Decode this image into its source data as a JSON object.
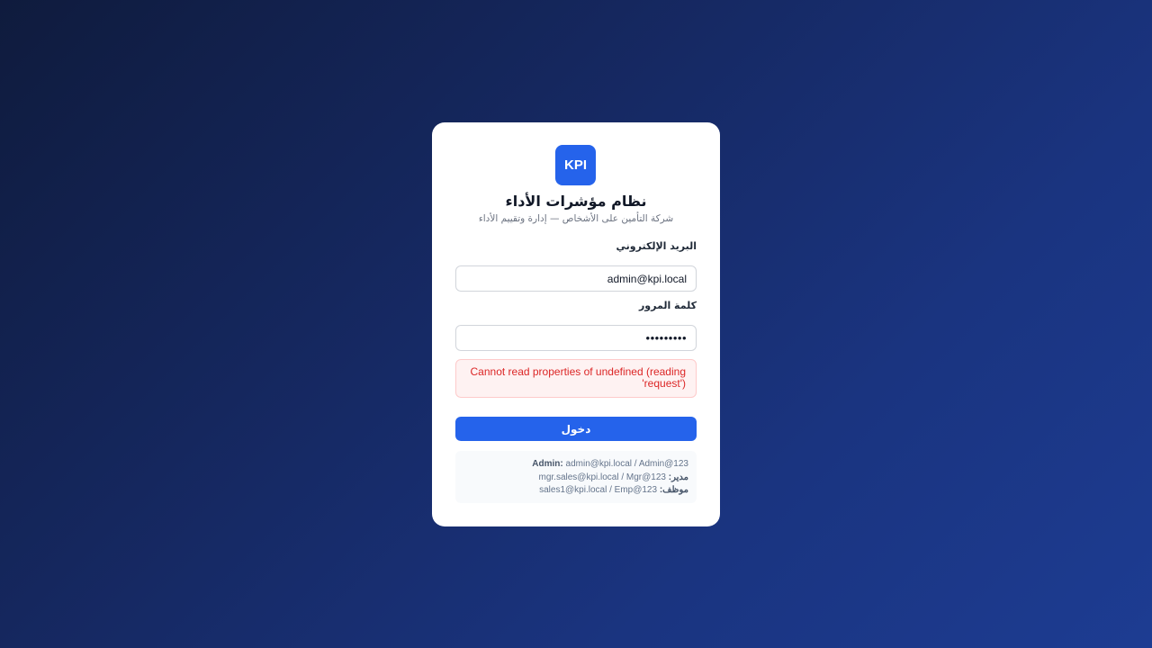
{
  "logo": {
    "text": "KPI"
  },
  "title": "نظام مؤشرات الأداء",
  "subtitle": "شركة التأمين على الأشخاص — إدارة وتقييم الأداء",
  "form": {
    "email_label": "البريد الإلكتروني",
    "email_value": "admin@kpi.local",
    "password_label": "كلمة المرور",
    "password_value": "•••••••••",
    "error_message": "Cannot read properties of undefined (reading 'request')",
    "submit_label": "دخول"
  },
  "hints": [
    {
      "role": "Admin:",
      "credentials": "admin@kpi.local / Admin@123"
    },
    {
      "role": "مدير:",
      "credentials": "mgr.sales@kpi.local / Mgr@123"
    },
    {
      "role": "موظف:",
      "credentials": "sales1@kpi.local / Emp@123"
    }
  ],
  "colors": {
    "accent": "#2563eb",
    "error_text": "#dc2626",
    "error_bg": "#fef2f2"
  }
}
